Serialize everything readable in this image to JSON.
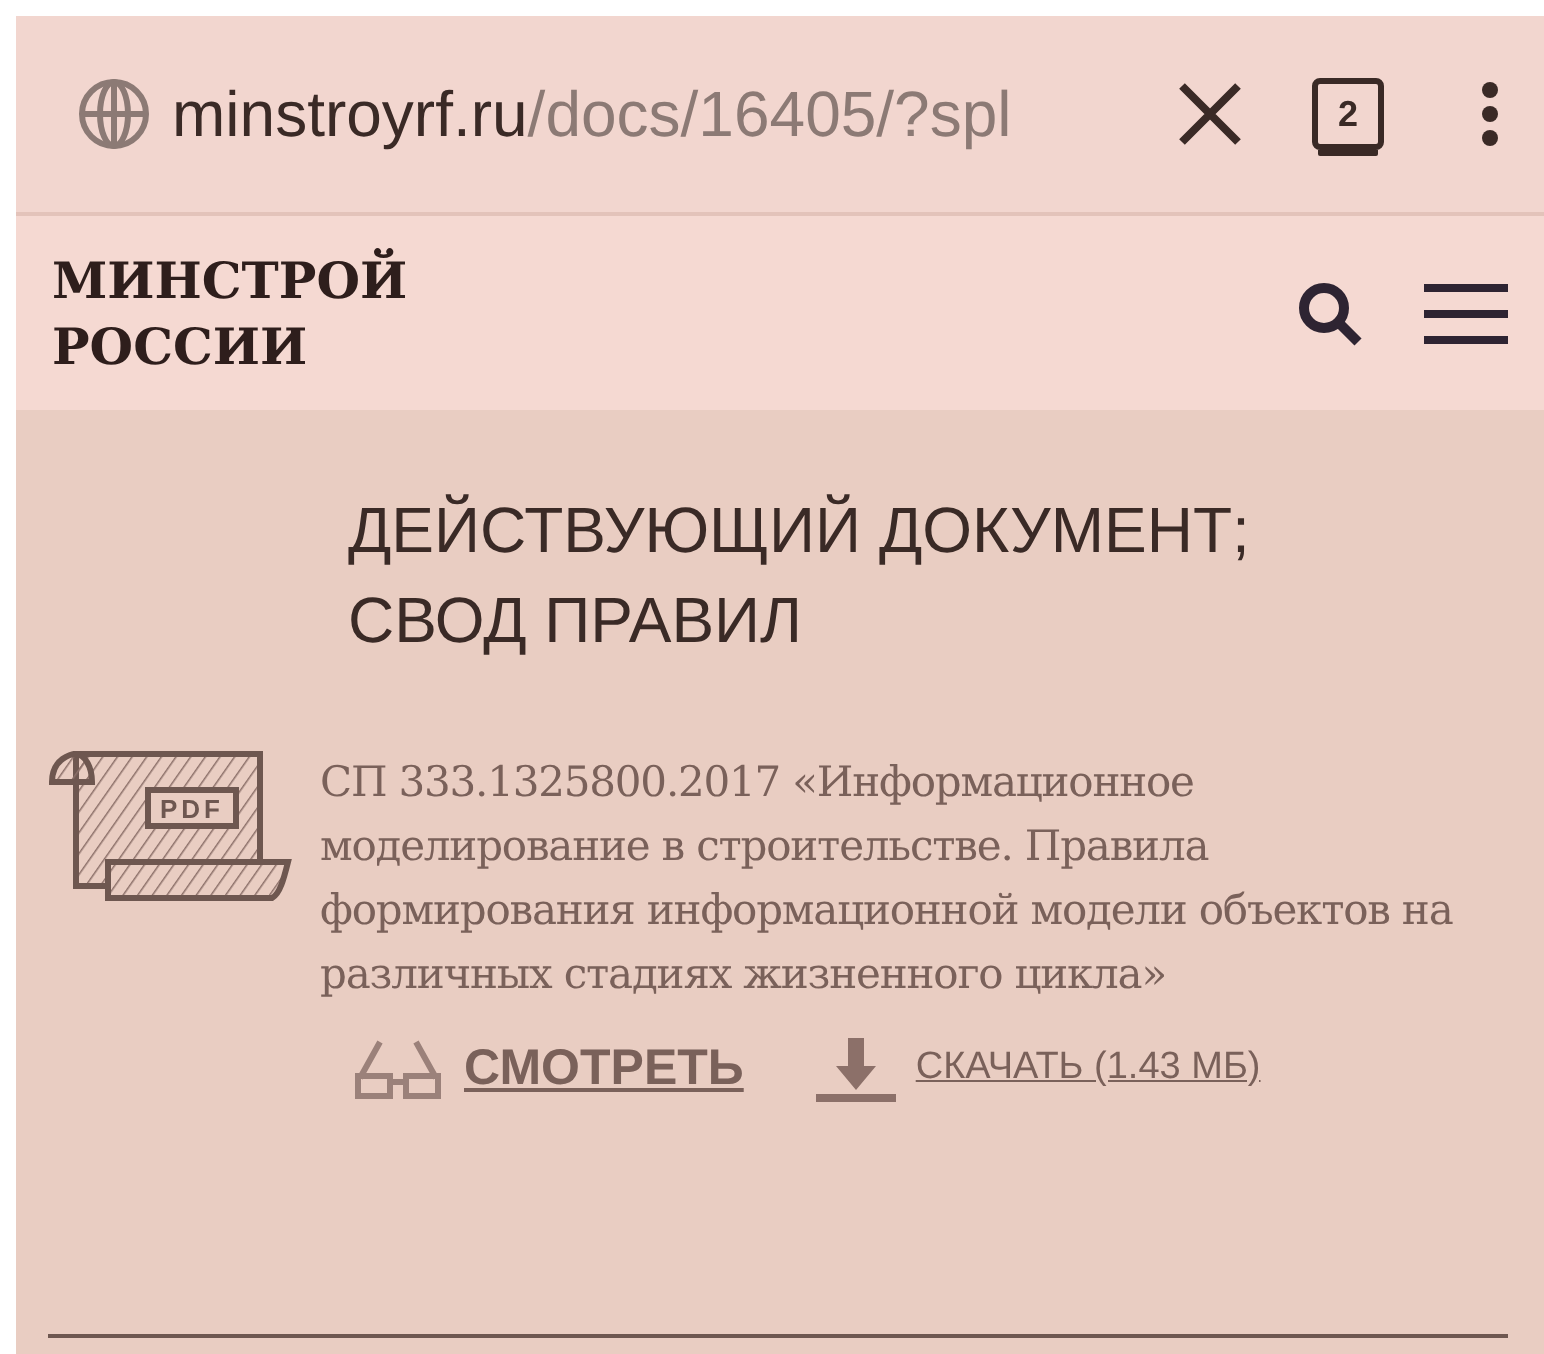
{
  "browser_bar": {
    "domain": "minstroyrf.ru",
    "path": "/docs/16405/?spl",
    "tab_count": "2"
  },
  "header": {
    "logo_lines": [
      "МИНСТРОЙ",
      "РОССИИ"
    ]
  },
  "document": {
    "status": "ДЕЙСТВУЮЩИЙ ДОКУМЕНТ; СВОД ПРАВИЛ",
    "file_badge": "PDF",
    "description": "СП 333.1325800.2017 «Информационное моделирование в строительстве. Правила формирования информационной модели объектов на различных стадиях жизненного цикла»",
    "actions": [
      {
        "kind": "view",
        "label": "СМОТРЕТЬ"
      },
      {
        "kind": "download",
        "label": "СКАЧАТЬ (1.43 МБ)"
      }
    ]
  }
}
